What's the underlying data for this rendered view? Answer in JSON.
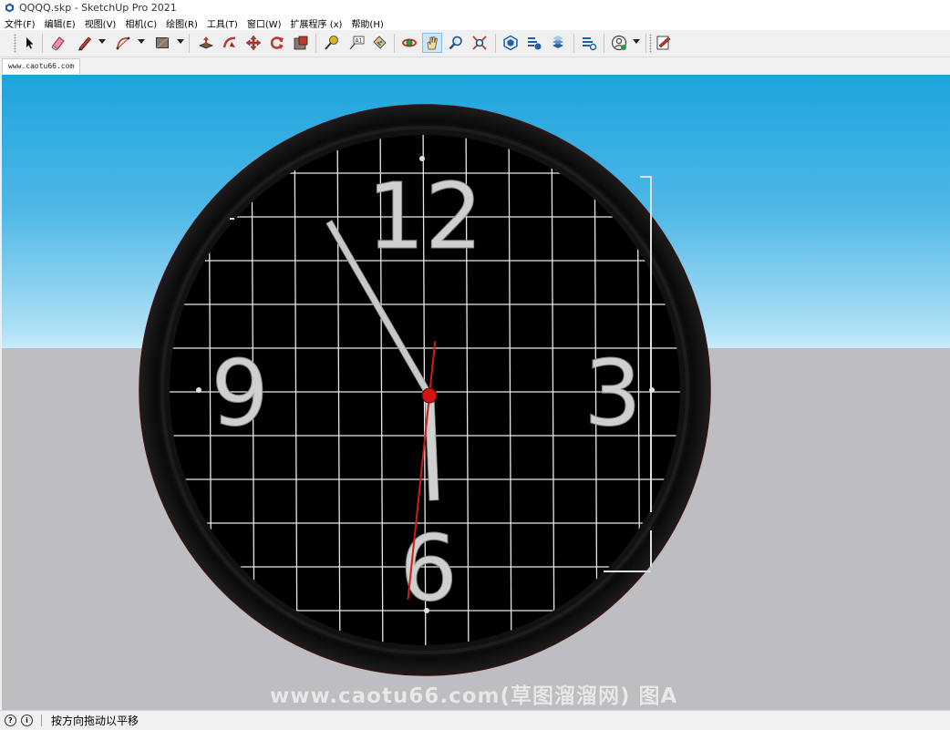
{
  "window": {
    "title": "QQQQ.skp - SketchUp Pro 2021"
  },
  "menu": [
    "文件(F)",
    "编辑(E)",
    "视图(V)",
    "相机(C)",
    "绘图(R)",
    "工具(T)",
    "窗口(W)",
    "扩展程序 (x)",
    "帮助(H)"
  ],
  "toolbar": {
    "active_tool": "pan",
    "icons": [
      "select-icon",
      "eraser-icon",
      "pencil-line-icon",
      "arc-icon",
      "rectangle-icon",
      "push-pull-icon",
      "follow-me-icon",
      "move-icon",
      "rotate-icon",
      "scale-icon",
      "tape-measure-icon",
      "text-label-icon",
      "paint-bucket-icon",
      "orbit-icon",
      "pan-hand-icon",
      "zoom-icon",
      "zoom-extents-icon",
      "warehouse-icon",
      "extension-warehouse-icon",
      "layout-icon",
      "extension-manager-icon",
      "profile-icon",
      "sketch-edit-icon"
    ]
  },
  "scene_tab": {
    "label": "www.caotu66.com"
  },
  "clock": {
    "numerals": [
      "12",
      "3",
      "6",
      "9"
    ],
    "time": {
      "hour": 5,
      "minute": 55,
      "second": 31
    },
    "colors": {
      "frame": "#0e0e0e",
      "face": "#000000",
      "grid": "#e8e8e8",
      "numerals": "#cfcfcf",
      "hands": "#c8c8c8",
      "second_hand": "#d11a1a",
      "center_cap": "#d01515"
    }
  },
  "viewport": {
    "colors": {
      "sky_top": "#1da4dd",
      "sky_horizon": "#c9ecfa",
      "ground": "#bdbdc2"
    }
  },
  "watermark": {
    "text": "www.caotu66.com(草图溜溜网) 图A"
  },
  "statusbar": {
    "text": "按方向拖动以平移"
  }
}
